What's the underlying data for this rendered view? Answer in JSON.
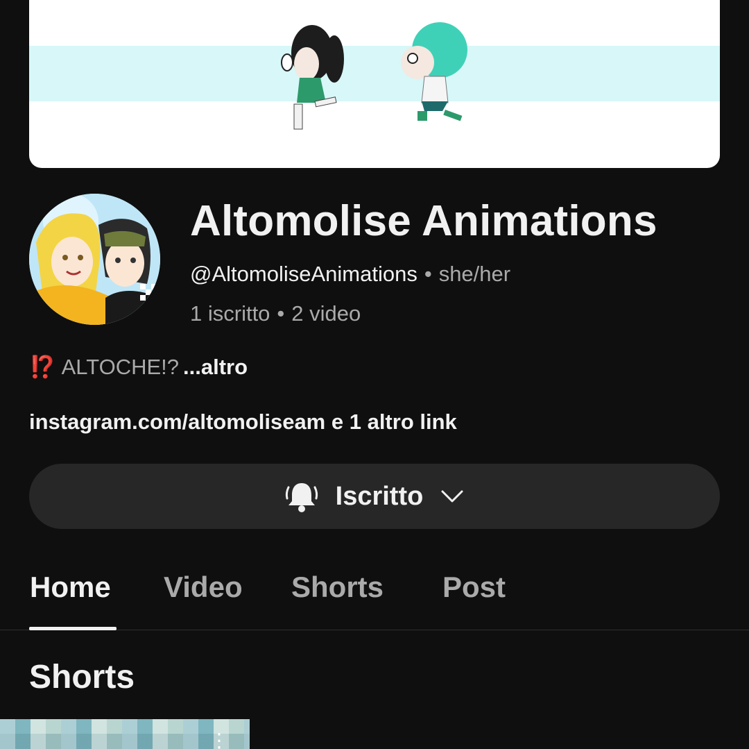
{
  "channel": {
    "name": "Altomolise Animations",
    "handle": "@AltomoliseAnimations",
    "pronouns": "she/her",
    "subscribers": "1 iscritto",
    "videos": "2 video",
    "separator": "•"
  },
  "description": {
    "emoji": "⁉️",
    "text": "ALTOCHE!?",
    "more": "...altro"
  },
  "links": {
    "primary": "instagram.com/altomoliseam",
    "more": "e 1 altro link"
  },
  "subscribe": {
    "label": "Iscritto",
    "bell_icon": "bell-ringing-icon",
    "chevron_icon": "chevron-down-icon"
  },
  "tabs": [
    {
      "label": "Home",
      "active": true
    },
    {
      "label": "Video",
      "active": false
    },
    {
      "label": "Shorts",
      "active": false
    },
    {
      "label": "Post",
      "active": false
    }
  ],
  "sections": {
    "shorts_title": "Shorts"
  },
  "colors": {
    "background": "#0f0f0f",
    "text_primary": "#f1f1f1",
    "text_secondary": "#aaaaaa",
    "button_bg": "#272727",
    "banner_stripe": "#d7f7f8"
  }
}
